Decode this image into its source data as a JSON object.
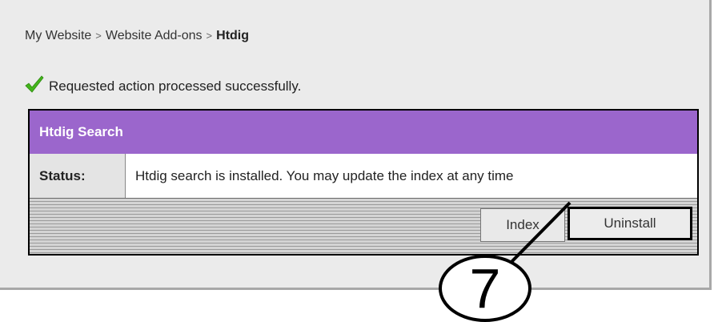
{
  "breadcrumb": {
    "item1": "My Website",
    "item2": "Website Add-ons",
    "current": "Htdig",
    "separator": ">"
  },
  "message": {
    "icon": "checkmark-icon",
    "text": "Requested action processed successfully."
  },
  "box": {
    "title": "Htdig Search",
    "status_label": "Status:",
    "status_value": "Htdig search is installed. You may update the index at any time"
  },
  "buttons": {
    "index": "Index",
    "uninstall": "Uninstall"
  },
  "callout": {
    "number": "7"
  },
  "colors": {
    "header": "#9b66cc",
    "panel": "#ebebeb",
    "check": "#43b51b"
  }
}
